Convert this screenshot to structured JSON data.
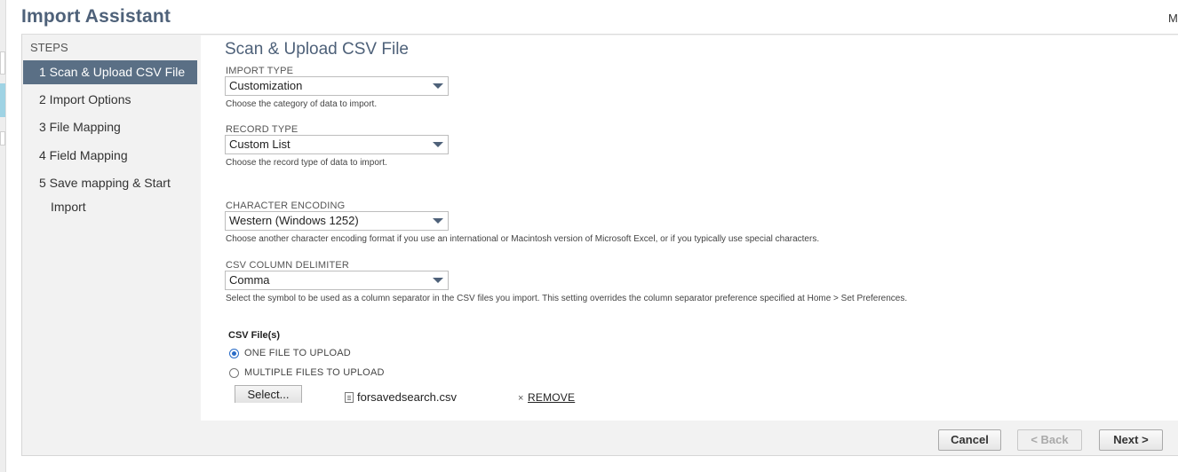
{
  "header": {
    "title": "Import Assistant",
    "corner_text": "M"
  },
  "sidebar": {
    "steps_label": "STEPS",
    "items": [
      {
        "label": "1 Scan & Upload CSV File",
        "active": true
      },
      {
        "label": "2 Import Options"
      },
      {
        "label": "3 File Mapping"
      },
      {
        "label": "4 Field Mapping"
      },
      {
        "label_line1": "5 Save mapping & Start",
        "label_line2": "Import"
      }
    ]
  },
  "main": {
    "title": "Scan & Upload CSV File",
    "import_type": {
      "label": "IMPORT TYPE",
      "value": "Customization",
      "help": "Choose the category of data to import."
    },
    "record_type": {
      "label": "RECORD TYPE",
      "value": "Custom List",
      "help": "Choose the record type of data to import."
    },
    "character_encoding": {
      "label": "CHARACTER ENCODING",
      "value": "Western (Windows 1252)",
      "help": "Choose another character encoding format if you use an international or Macintosh version of Microsoft Excel, or if you typically use special characters."
    },
    "csv_delimiter": {
      "label": "CSV COLUMN DELIMITER",
      "value": "Comma",
      "help": "Select the symbol to be used as a column separator in the CSV files you import. This setting overrides the column separator preference specified at Home > Set Preferences."
    },
    "csv_files": {
      "label": "CSV File(s)",
      "option_one": "ONE FILE TO UPLOAD",
      "option_multiple": "MULTIPLE FILES TO UPLOAD",
      "selected_option": "one",
      "select_button": "Select...",
      "file_name": "forsavedsearch.csv",
      "remove_x": "×",
      "remove_label": "REMOVE"
    }
  },
  "footer": {
    "cancel": "Cancel",
    "back": "< Back",
    "next": "Next >"
  },
  "colors": {
    "accent": "#4e6179",
    "active_step": "#5a6f85",
    "radio_selected": "#2a6cc7"
  }
}
